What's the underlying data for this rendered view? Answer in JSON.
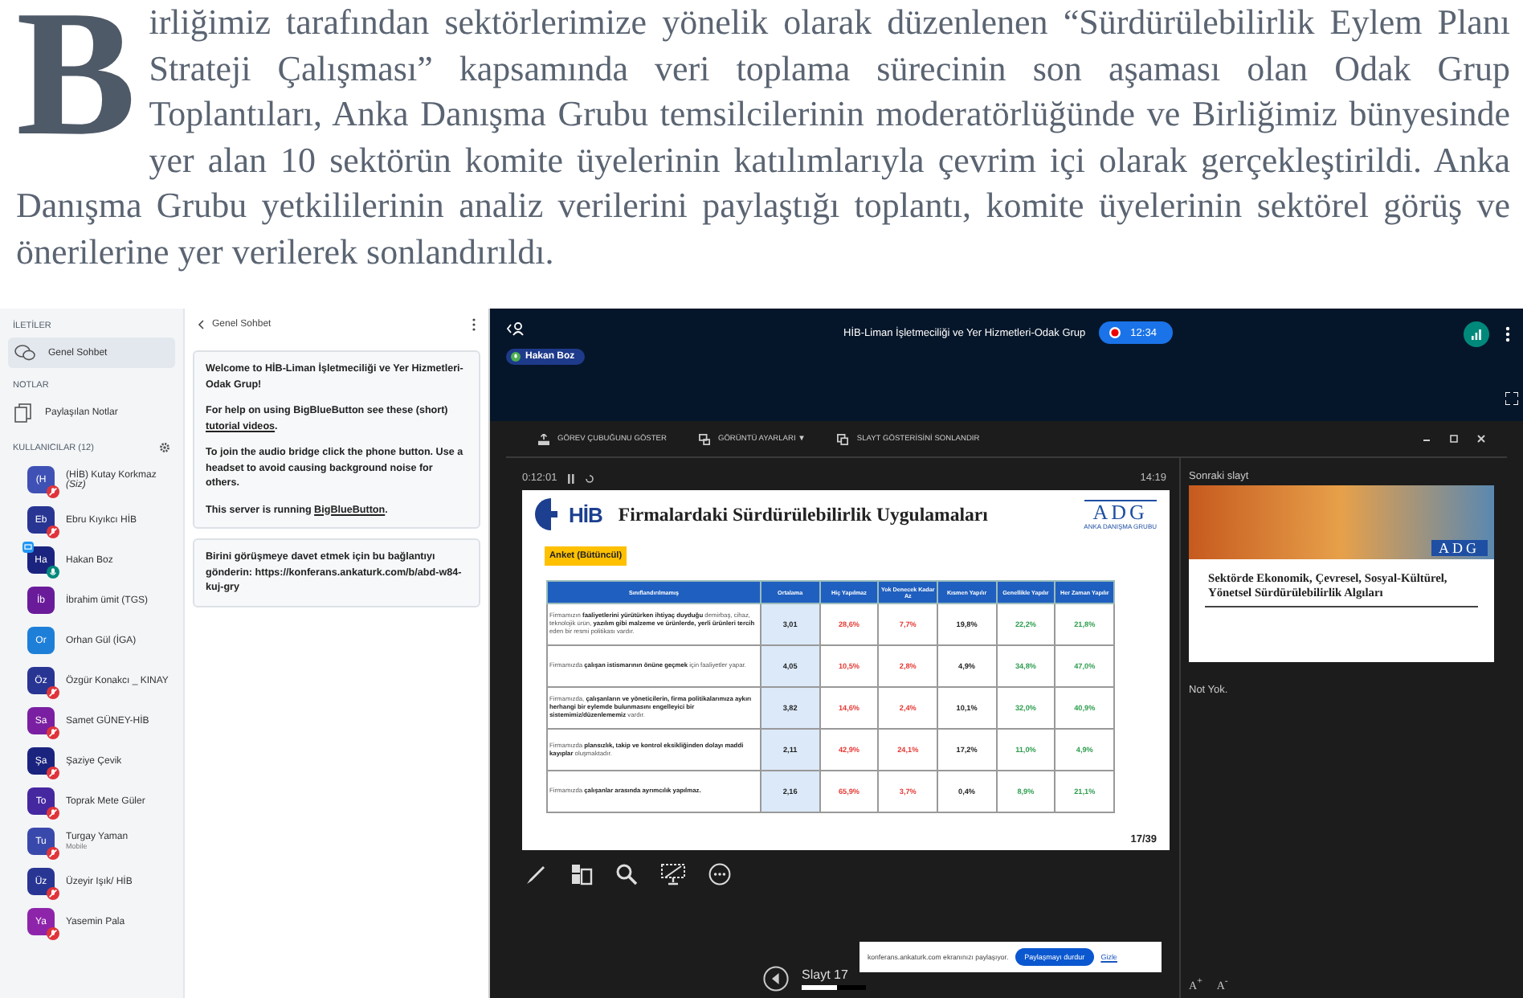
{
  "article": {
    "drop_cap": "B",
    "text": "irliğimiz tarafından sektörlerimize yönelik olarak düzenlenen “Sürdürülebilirlik Eylem Planı Strateji Çalışması” kapsamında veri toplama sürecinin son aşaması olan Odak Grup Toplantıları, Anka Danışma Grubu temsilcilerinin moderatörlüğünde ve Birliğimiz bünyesinde yer alan 10 sektörün komite üyelerinin katılımlarıyla çevrim içi olarak gerçekleştirildi. Anka Danışma Grubu yetkililerinin analiz verilerini paylaştığı toplantı, komite üyelerinin sektörel görüş ve önerilerine yer verilerek sonlandırıldı."
  },
  "meeting": {
    "sidebar": {
      "messages_heading": "İLETİLER",
      "chat_item": {
        "label": "Genel Sohbet",
        "selected": true
      },
      "notes_heading": "NOTLAR",
      "notes_item": "Paylaşılan Notlar",
      "users_heading": "KULLANICILAR (12)",
      "users": [
        {
          "initials": "(H",
          "name": "(HİB) Kutay Korkmaz *(Siz)*",
          "color": "#3f51b5",
          "muted": true,
          "talking": false,
          "presenter": false
        },
        {
          "initials": "Eb",
          "name": "Ebru Kıyıkcı HİB",
          "color": "#283593",
          "muted": true,
          "talking": false,
          "presenter": false
        },
        {
          "initials": "Ha",
          "name": "Hakan Boz",
          "color": "#1a237e",
          "muted": false,
          "talking": true,
          "presenter": true
        },
        {
          "initials": "İb",
          "name": "İbrahim ümit (TGS)",
          "color": "#6a1b9a",
          "muted": false,
          "talking": false,
          "presenter": false
        },
        {
          "initials": "Or",
          "name": "Orhan Gül (İGA)",
          "color": "#1e7fd8",
          "muted": false,
          "talking": false,
          "presenter": false
        },
        {
          "initials": "Öz",
          "name": "Özgür Konakcı _ KINAY",
          "color": "#283593",
          "muted": true,
          "talking": false,
          "presenter": false
        },
        {
          "initials": "Sa",
          "name": "Samet GÜNEY-HİB",
          "color": "#7b1fa2",
          "muted": true,
          "talking": false,
          "presenter": false
        },
        {
          "initials": "Şa",
          "name": "Şaziye Çevik",
          "color": "#1a237e",
          "muted": true,
          "talking": false,
          "presenter": false
        },
        {
          "initials": "To",
          "name": "Toprak Mete Güler",
          "color": "#4527a0",
          "muted": true,
          "talking": false,
          "presenter": false
        },
        {
          "initials": "Tu",
          "name": "Turgay Yaman",
          "subtitle": "Mobile",
          "color": "#3949ab",
          "muted": true,
          "talking": false,
          "presenter": false
        },
        {
          "initials": "Üz",
          "name": "Üzeyir Işık/ HİB",
          "color": "#283593",
          "muted": true,
          "talking": false,
          "presenter": false
        },
        {
          "initials": "Ya",
          "name": "Yasemin Pala",
          "color": "#8e24aa",
          "muted": true,
          "talking": false,
          "presenter": false
        }
      ]
    },
    "chat": {
      "title": "Genel Sohbet",
      "messages": [
        {
          "paragraphs": [
            {
              "text": "Welcome to HİB-Liman İşletmeciliği ve Yer Hizmetleri-Odak Grup!"
            },
            {
              "text": "For help on using BigBlueButton see these (short) ",
              "link": "tutorial videos",
              "after": "."
            },
            {
              "text": "To join the audio bridge click the phone button. Use a headset to avoid causing background noise for others."
            },
            {
              "text": "This server is running ",
              "link": "BigBlueButton",
              "after": "."
            }
          ]
        },
        {
          "paragraphs": [
            {
              "text": "Birini görüşmeye davet etmek için bu bağlantıyı gönderin: https://konferans.ankaturk.com/b/abd-w84-kuj-gry"
            }
          ]
        }
      ]
    },
    "header": {
      "title": "HİB-Liman İşletmeciliği ve Yer Hizmetleri-Odak Grup",
      "recording_time": "12:34",
      "talker": "Hakan Boz"
    },
    "toolbar": [
      {
        "label": "GÖREV ÇUBUĞUNU GÖSTER"
      },
      {
        "label": "GÖRÜNTÜ AYARLARI ▼"
      },
      {
        "label": "SLAYT GÖSTERİSİNİ SONLANDIR"
      }
    ],
    "presenter": {
      "elapsed": "0:12:01",
      "clock": "14:19",
      "slide": {
        "logo": "HİB",
        "title": "Firmalardaki Sürdürülebilirlik Uygulamaları",
        "partner_logo": "ADG",
        "partner_name": "ANKA DANIŞMA GRUBU",
        "badge": "Anket (Bütüncül)",
        "page": "17/39",
        "table": {
          "columns": [
            {
              "label": "Sınıflandırılmamış",
              "highlight": false
            },
            {
              "label": "Ortalama",
              "highlight": true,
              "color": "#222222"
            },
            {
              "label": "Hiç Yapılmaz",
              "highlight": false,
              "color": "#e53935"
            },
            {
              "label": "Yok Denecek Kadar Az",
              "highlight": false,
              "color": "#e53935"
            },
            {
              "label": "Kısmen Yapılır",
              "highlight": false,
              "color": "#222222"
            },
            {
              "label": "Genellikle Yapılır",
              "highlight": false,
              "color": "#2e9e4f"
            },
            {
              "label": "Her Zaman Yapılır",
              "highlight": false,
              "color": "#2e9e4f"
            }
          ],
          "rows": [
            {
              "statement": "Firmamızın **faaliyetlerini yürütürken ihtiyaç duyduğu** demirbaş, cihaz, teknolojik ürün, **yazılım gibi malzeme ve ürünlerde, yerli ürünleri tercih** eden bir resmi politikası vardır.",
              "values": [
                "3,01",
                "28,6%",
                "7,7%",
                "19,8%",
                "22,2%",
                "21,8%"
              ]
            },
            {
              "statement": "Firmamızda **çalışan istismarının önüne geçmek** için faaliyetler yapar.",
              "values": [
                "4,05",
                "10,5%",
                "2,8%",
                "4,9%",
                "34,8%",
                "47,0%"
              ]
            },
            {
              "statement": "Firmamızda, **çalışanların ve yöneticilerin, firma politikalarımıza aykırı herhangi bir eylemde bulunmasını engelleyici bir sistemimiz/düzenlememiz** vardır.",
              "values": [
                "3,82",
                "14,6%",
                "2,4%",
                "10,1%",
                "32,0%",
                "40,9%"
              ]
            },
            {
              "statement": "Firmamızda **plansızlık, takip ve kontrol eksikliğinden dolayı maddi kayıplar** oluşmaktadır.",
              "values": [
                "2,11",
                "42,9%",
                "24,1%",
                "17,2%",
                "11,0%",
                "4,9%"
              ]
            },
            {
              "statement": "Firmamızda **çalışanlar arasında ayrımcılık yapılmaz.**",
              "values": [
                "2,16",
                "65,9%",
                "3,7%",
                "0,4%",
                "8,9%",
                "21,1%"
              ]
            }
          ]
        }
      },
      "slide_label": "Slayt 17",
      "progress": {
        "level": 0.55
      },
      "share_bar": {
        "message": "konferans.ankaturk.com ekranınızı paylaşıyor.",
        "stop_button": "Paylaşmayı durdur",
        "hide_link": "Gizle"
      }
    },
    "next_slide": {
      "label": "Sonraki slayt",
      "logo": "ADG",
      "title": "Sektörde Ekonomik, Çevresel, Sosyal-Kültürel, Yönetsel Sürdürülebilirlik Algıları",
      "notes": "Not Yok.",
      "font_buttons": [
        "A$^{+}$",
        "A$^{-}$"
      ]
    }
  }
}
